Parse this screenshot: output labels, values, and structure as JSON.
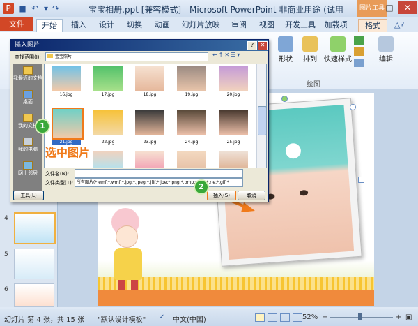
{
  "window": {
    "title": "宝宝相册.ppt [兼容模式] - Microsoft PowerPoint 非商业用途 (试用版)",
    "picture_tools": "图片工具"
  },
  "tabs": {
    "file": "文件",
    "items": [
      "开始",
      "插入",
      "设计",
      "切换",
      "动画",
      "幻灯片放映",
      "审阅",
      "视图",
      "开发工具",
      "加载项",
      "格式"
    ]
  },
  "ribbon": {
    "shape": "形状",
    "arrange": "排列",
    "quick_styles": "快速样式",
    "edit": "编辑",
    "group_drawing": "绘图"
  },
  "thumbs": [
    {
      "num": "4"
    },
    {
      "num": "5"
    },
    {
      "num": "6"
    }
  ],
  "dialog": {
    "title": "插入图片",
    "lookin_label": "查找范围(I):",
    "lookin_value": "宝宝照片",
    "places": [
      "我最近的文档",
      "桌面",
      "我的文档",
      "我的电脑",
      "网上邻居"
    ],
    "files_row1": [
      "16.jpg",
      "17.jpg",
      "18.jpg",
      "19.jpg",
      "20.jpg"
    ],
    "files_row2": [
      "21.jpg",
      "22.jpg",
      "23.jpg",
      "24.jpg",
      "25.jpg"
    ],
    "files_row3": [
      "",
      "",
      "",
      "",
      ""
    ],
    "filename_label": "文件名(N):",
    "filetype_label": "文件类型(T):",
    "filetype_value": "所有图片(*.emf;*.wmf;*.jpg;*.jpeg;*.jfif;*.jpe;*.png;*.bmp;*.dib;*.rle;*.gif;*",
    "tools": "工具(L)",
    "insert": "插入(S)",
    "cancel": "取消",
    "annotation_select": "选中图片",
    "badge1": "1",
    "badge2": "2"
  },
  "status": {
    "slide_info": "幻灯片 第 4 张，共 15 张",
    "theme": "\"默认设计模板\"",
    "language": "中文(中国)",
    "zoom": "52%"
  }
}
